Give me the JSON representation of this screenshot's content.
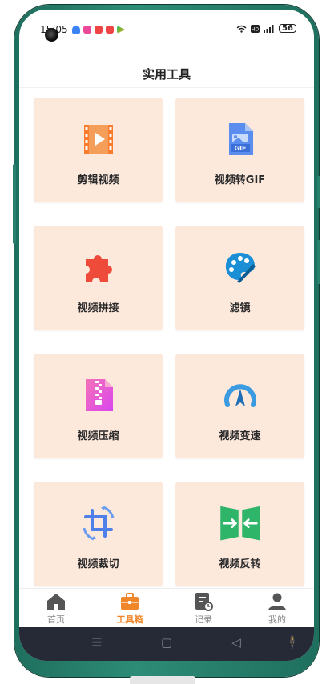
{
  "status": {
    "time": "15:05",
    "battery": "56"
  },
  "header": {
    "title": "实用工具"
  },
  "tools": [
    {
      "label": "剪辑视频",
      "icon": "film-edit-icon"
    },
    {
      "label": "视频转GIF",
      "icon": "gif-file-icon"
    },
    {
      "label": "视频拼接",
      "icon": "puzzle-icon"
    },
    {
      "label": "滤镜",
      "icon": "palette-icon"
    },
    {
      "label": "视频压缩",
      "icon": "zip-file-icon"
    },
    {
      "label": "视频变速",
      "icon": "speed-gauge-icon"
    },
    {
      "label": "视频裁切",
      "icon": "crop-rotate-icon"
    },
    {
      "label": "视频反转",
      "icon": "reverse-arrows-icon"
    }
  ],
  "tabbar": {
    "items": [
      {
        "label": "首页",
        "icon": "home-icon"
      },
      {
        "label": "工具箱",
        "icon": "toolbox-icon",
        "active": true
      },
      {
        "label": "记录",
        "icon": "record-icon"
      },
      {
        "label": "我的",
        "icon": "profile-icon"
      }
    ]
  },
  "colors": {
    "accent": "#f0862a",
    "card_bg": "#fde8dc",
    "frame": "#2d8c76"
  }
}
